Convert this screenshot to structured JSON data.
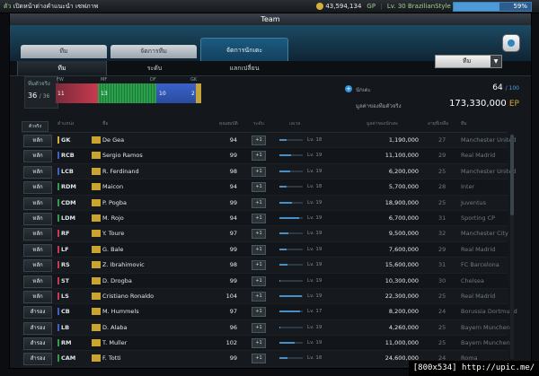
{
  "topbar": {
    "left_num": "ตัว",
    "left_text": "เปิดหน้าต่างคำแนะนำ",
    "left_tag": "เซฟภาพ",
    "gp": "43,594,134",
    "gp_unit": "GP",
    "level_text": "Lv. 30 BrazilianStyle",
    "xp_percent": "59%",
    "xp_fraction": 0.59
  },
  "window": {
    "title": "Team"
  },
  "tabs": [
    "ทีม",
    "จัดการทีม",
    "จัดการนักเตะ"
  ],
  "subtabs": [
    "ทีม",
    "ระดับ",
    "แลกเปลี่ยน"
  ],
  "dropdown": {
    "value": "ทีม"
  },
  "summary": {
    "label": "ทีมตัวจริง",
    "count": "36",
    "count_max": "/ 36",
    "fw_label": "FW",
    "fw": "11",
    "mf_label": "MF",
    "mf": "13",
    "df_label": "DF",
    "df": "10",
    "gk_label": "GK",
    "gk": "2",
    "players_label": "นักเตะ",
    "players": "64",
    "players_max": "/ 100",
    "value_label": "มูลค่าของทีมตัวจริง",
    "value": "173,330,000",
    "value_unit": "EP"
  },
  "table": {
    "sort": "ตัวจริง",
    "headers": [
      "ตำแหน่ง",
      "ชื่อ",
      "คุณสมบัติ",
      "ระดับ",
      "เลเวล",
      "มูลค่าของนักเตะ",
      "อายุที่เหลือ",
      "ทีม"
    ],
    "rows": [
      {
        "status": "หลัก",
        "pos": "GK",
        "name": "De Gea",
        "ovr": "94",
        "level": "Lv. 18",
        "lvl": 0.3,
        "price": "1,190,000",
        "age": "27",
        "club": "Manchester United",
        "color": "#d4b13c"
      },
      {
        "status": "หลัก",
        "pos": "RCB",
        "name": "Sergio Ramos",
        "ovr": "99",
        "level": "Lv. 19",
        "lvl": 0.5,
        "price": "11,100,000",
        "age": "29",
        "club": "Real Madrid",
        "color": "#3b62c8"
      },
      {
        "status": "หลัก",
        "pos": "LCB",
        "name": "R. Ferdinand",
        "ovr": "98",
        "level": "Lv. 19",
        "lvl": 0.45,
        "price": "6,200,000",
        "age": "25",
        "club": "Manchester United",
        "color": "#3b62c8"
      },
      {
        "status": "หลัก",
        "pos": "RDM",
        "name": "Maicon",
        "ovr": "94",
        "level": "Lv. 18",
        "lvl": 0.3,
        "price": "5,700,000",
        "age": "28",
        "club": "Inter",
        "color": "#2aa04a"
      },
      {
        "status": "หลัก",
        "pos": "CDM",
        "name": "P. Pogba",
        "ovr": "99",
        "level": "Lv. 19",
        "lvl": 0.55,
        "price": "18,900,000",
        "age": "25",
        "club": "Juventus",
        "color": "#2aa04a"
      },
      {
        "status": "หลัก",
        "pos": "LDM",
        "name": "M. Rojo",
        "ovr": "94",
        "level": "Lv. 19",
        "lvl": 0.85,
        "price": "6,700,000",
        "age": "31",
        "club": "Sporting CP",
        "color": "#2aa04a"
      },
      {
        "status": "หลัก",
        "pos": "RF",
        "name": "Y. Toure",
        "ovr": "97",
        "level": "Lv. 19",
        "lvl": 0.4,
        "price": "9,500,000",
        "age": "32",
        "club": "Manchester City",
        "color": "#c83a50"
      },
      {
        "status": "หลัก",
        "pos": "LF",
        "name": "G. Bale",
        "ovr": "99",
        "level": "Lv. 19",
        "lvl": 0.3,
        "price": "7,600,000",
        "age": "29",
        "club": "Real Madrid",
        "color": "#c83a50"
      },
      {
        "status": "หลัก",
        "pos": "RS",
        "name": "Z. Ibrahimovic",
        "ovr": "98",
        "level": "Lv. 19",
        "lvl": 0.35,
        "price": "15,600,000",
        "age": "31",
        "club": "FC Barcelona",
        "color": "#c83a50"
      },
      {
        "status": "หลัก",
        "pos": "ST",
        "name": "D. Drogba",
        "ovr": "99",
        "level": "Lv. 19",
        "lvl": 0.05,
        "price": "10,300,000",
        "age": "30",
        "club": "Chelsea",
        "color": "#c83a50"
      },
      {
        "status": "หลัก",
        "pos": "LS",
        "name": "Cristiano Ronaldo",
        "ovr": "104",
        "level": "Lv. 19",
        "lvl": 0.95,
        "price": "22,300,000",
        "age": "25",
        "club": "Real Madrid",
        "color": "#c83a50"
      },
      {
        "status": "สำรอง",
        "pos": "CB",
        "name": "M. Hummels",
        "ovr": "97",
        "level": "Lv. 17",
        "lvl": 0.9,
        "price": "8,200,000",
        "age": "24",
        "club": "Borussia Dortmund",
        "color": "#3b62c8"
      },
      {
        "status": "สำรอง",
        "pos": "LB",
        "name": "D. Alaba",
        "ovr": "96",
        "level": "Lv. 19",
        "lvl": 0.05,
        "price": "4,260,000",
        "age": "25",
        "club": "Bayern Munchen",
        "color": "#3b62c8"
      },
      {
        "status": "สำรอง",
        "pos": "RM",
        "name": "T. Muller",
        "ovr": "102",
        "level": "Lv. 19",
        "lvl": 0.65,
        "price": "11,000,000",
        "age": "25",
        "club": "Bayern Munchen",
        "color": "#2aa04a"
      },
      {
        "status": "สำรอง",
        "pos": "CAM",
        "name": "F. Totti",
        "ovr": "99",
        "level": "Lv. 18",
        "lvl": 0.35,
        "price": "24,600,000",
        "age": "24",
        "club": "Roma",
        "color": "#2aa04a"
      }
    ]
  },
  "footer": "[800x534] http://upic.me/"
}
